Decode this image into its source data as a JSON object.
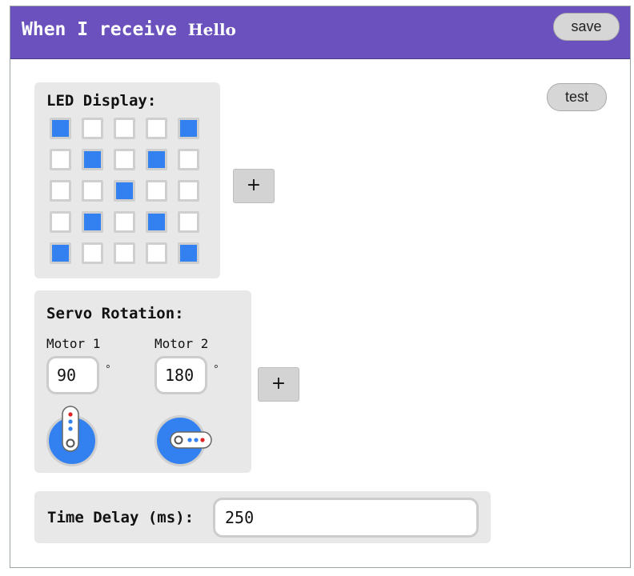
{
  "header": {
    "prefix": "When I receive ",
    "message": "Hello",
    "save_label": "save",
    "background": "#6a51bd"
  },
  "test_label": "test",
  "led_display": {
    "title": "LED Display:",
    "on_color": "#3381f0",
    "grid": [
      [
        1,
        0,
        0,
        0,
        1
      ],
      [
        0,
        1,
        0,
        1,
        0
      ],
      [
        0,
        0,
        1,
        0,
        0
      ],
      [
        0,
        1,
        0,
        1,
        0
      ],
      [
        1,
        0,
        0,
        0,
        1
      ]
    ],
    "add_label": "+"
  },
  "servo": {
    "title": "Servo Rotation:",
    "motors": [
      {
        "label": "Motor 1",
        "degrees": "90",
        "unit": "°"
      },
      {
        "label": "Motor 2",
        "degrees": "180",
        "unit": "°"
      }
    ],
    "add_label": "+"
  },
  "delay": {
    "label": "Time Delay (ms):",
    "value": "250"
  }
}
